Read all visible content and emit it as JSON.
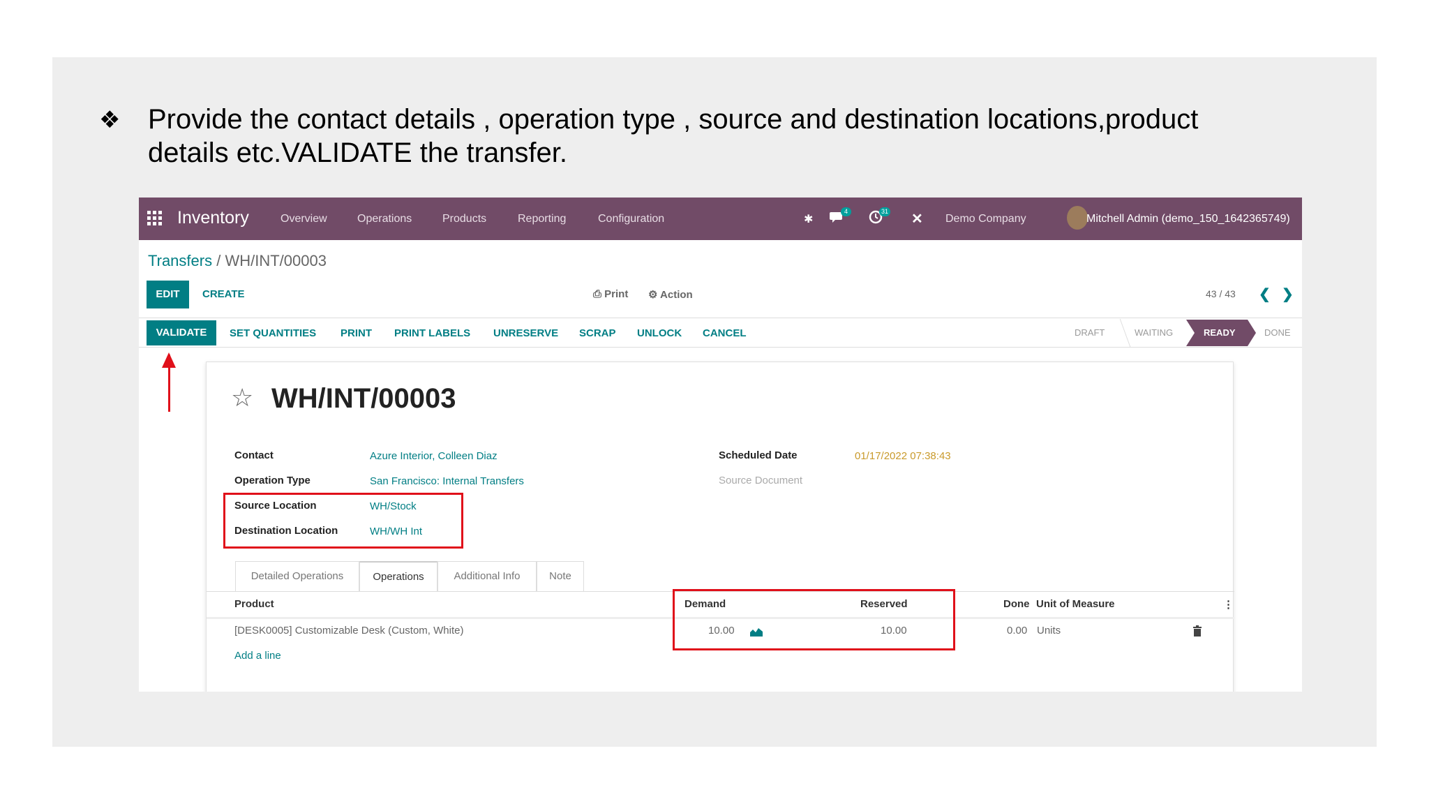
{
  "slide": {
    "bullet_glyph": "❖",
    "instruction": "Provide the contact details , operation type , source and destination locations,product details etc.VALIDATE the transfer."
  },
  "topbar": {
    "app_name": "Inventory",
    "menu": [
      "Overview",
      "Operations",
      "Products",
      "Reporting",
      "Configuration"
    ],
    "chat_badge": "4",
    "activity_badge": "31",
    "company": "Demo Company",
    "user": "Mitchell Admin (demo_150_1642365749)"
  },
  "breadcrumb": {
    "parent": "Transfers",
    "separator": " / ",
    "current": "WH/INT/00003"
  },
  "controlpanel": {
    "edit": "EDIT",
    "create": "CREATE",
    "print": "⎙ Print",
    "action": "⚙ Action",
    "pager": "43 / 43",
    "prev": "❮",
    "next": "❯"
  },
  "actions": {
    "validate": "VALIDATE",
    "set_quantities": "SET QUANTITIES",
    "print": "PRINT",
    "print_labels": "PRINT LABELS",
    "unreserve": "UNRESERVE",
    "scrap": "SCRAP",
    "unlock": "UNLOCK",
    "cancel": "CANCEL"
  },
  "stages": {
    "draft": "DRAFT",
    "waiting": "WAITING",
    "ready": "READY",
    "done": "DONE"
  },
  "record": {
    "star": "☆",
    "title": "WH/INT/00003",
    "contact_label": "Contact",
    "contact_value": "Azure Interior, Colleen Diaz",
    "operation_type_label": "Operation Type",
    "operation_type_value": "San Francisco: Internal Transfers",
    "source_location_label": "Source Location",
    "source_location_value": "WH/Stock",
    "destination_location_label": "Destination Location",
    "destination_location_value": "WH/WH Int",
    "scheduled_date_label": "Scheduled Date",
    "scheduled_date_value": "01/17/2022 07:38:43",
    "source_document_label": "Source Document"
  },
  "tabs": [
    "Detailed Operations",
    "Operations",
    "Additional Info",
    "Note"
  ],
  "table": {
    "headers": {
      "product": "Product",
      "demand": "Demand",
      "reserved": "Reserved",
      "done": "Done",
      "uom": "Unit of Measure",
      "options": "⋮"
    },
    "rows": [
      {
        "product": "[DESK0005] Customizable Desk (Custom, White)",
        "demand": "10.00",
        "reserved": "10.00",
        "done": "0.00",
        "uom": "Units",
        "forecast_icon": "chart-area-icon",
        "delete_icon": "trash-icon"
      }
    ],
    "add_line": "Add a line"
  },
  "colors": {
    "brand": "#714b67",
    "primary": "#017e84",
    "highlight": "#e0101a"
  }
}
